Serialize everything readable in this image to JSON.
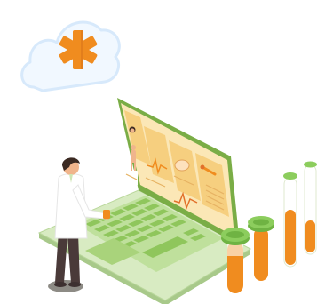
{
  "scene": {
    "palette": {
      "cloud_fill": "#f1f8ff",
      "cloud_stroke": "#d7e9fb",
      "asterisk": "#f08c1f",
      "laptop_body": "#cfe5b3",
      "laptop_dark": "#79ad45",
      "keys": "#a9d37b",
      "screen_bg": "#fce6b2",
      "panel": "#f6cf7f",
      "liquid": "#f08c1f",
      "cap": "#6fb343",
      "skin": "#f0b58c",
      "hair": "#3b2a22",
      "coat": "#ffffff",
      "pants": "#4a3a39",
      "shadow": "#8d8b85"
    },
    "icons": [
      "medical-asterisk-icon",
      "cloud-icon",
      "doctor-avatar-icon",
      "body-figure-icon",
      "ecg-waveform-icon",
      "pill-icon",
      "thermometer-icon"
    ]
  }
}
